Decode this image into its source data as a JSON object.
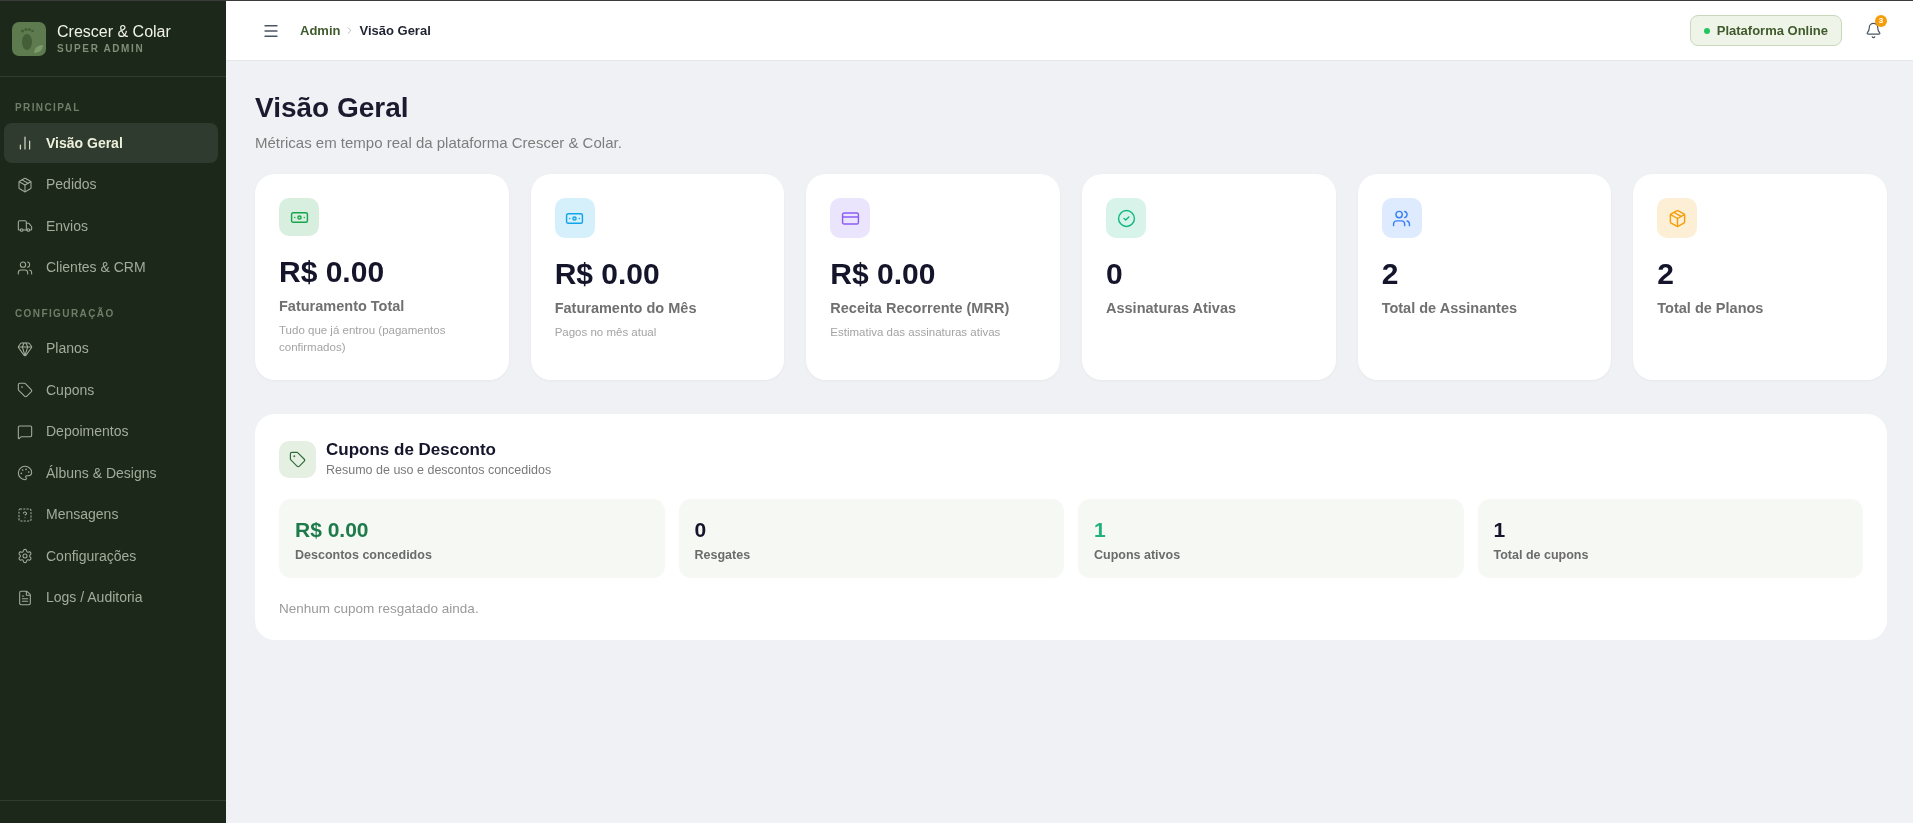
{
  "sidebar": {
    "brand": {
      "title": "Crescer & Colar",
      "subtitle": "SUPER ADMIN"
    },
    "sections": [
      {
        "title": "PRINCIPAL",
        "items": [
          {
            "label": "Visão Geral",
            "selected": true
          },
          {
            "label": "Pedidos",
            "selected": false
          },
          {
            "label": "Envios",
            "selected": false
          },
          {
            "label": "Clientes & CRM",
            "selected": false
          }
        ]
      },
      {
        "title": "CONFIGURAÇÃO",
        "items": [
          {
            "label": "Planos",
            "selected": false
          },
          {
            "label": "Cupons",
            "selected": false
          },
          {
            "label": "Depoimentos",
            "selected": false
          },
          {
            "label": "Álbuns & Designs",
            "selected": false
          },
          {
            "label": "Mensagens",
            "selected": false
          },
          {
            "label": "Configurações",
            "selected": false
          },
          {
            "label": "Logs / Auditoria",
            "selected": false
          }
        ]
      }
    ]
  },
  "header": {
    "breadcrumb": [
      "Admin",
      "Visão Geral"
    ],
    "status": {
      "label": "Plataforma Online",
      "online": true
    },
    "notifications": {
      "count": "3"
    }
  },
  "page": {
    "title": "Visão Geral",
    "subtitle": "Métricas em tempo real da plataforma Crescer & Colar."
  },
  "metrics": [
    {
      "value": "R$ 0.00",
      "label": "Faturamento Total",
      "description": "Tudo que já entrou (pagamentos confirmados)",
      "color": "#16a34a"
    },
    {
      "value": "R$ 0.00",
      "label": "Faturamento do Mês",
      "description": "Pagos no mês atual",
      "color": "#0ea5e9"
    },
    {
      "value": "R$ 0.00",
      "label": "Receita Recorrente (MRR)",
      "description": "Estimativa das assinaturas ativas",
      "color": "#8b5cf6"
    },
    {
      "value": "0",
      "label": "Assinaturas Ativas",
      "color": "#10b981"
    },
    {
      "value": "2",
      "label": "Total de Assinantes",
      "color": "#3b82f6"
    },
    {
      "value": "2",
      "label": "Total de Planos",
      "color": "#f59e0b"
    }
  ],
  "coupons": {
    "title": "Cupons de Desconto",
    "subtitle": "Resumo de uso e descontos concedidos",
    "stats": [
      {
        "value": "R$ 0.00",
        "label": "Descontos concedidos",
        "color": "#1e7a4a"
      },
      {
        "value": "0",
        "label": "Resgates",
        "color": "#14142b"
      },
      {
        "value": "1",
        "label": "Cupons ativos",
        "color": "#22b07d"
      },
      {
        "value": "1",
        "label": "Total de cupons",
        "color": "#14142b"
      }
    ],
    "empty_message": "Nenhum cupom resgatado ainda."
  }
}
